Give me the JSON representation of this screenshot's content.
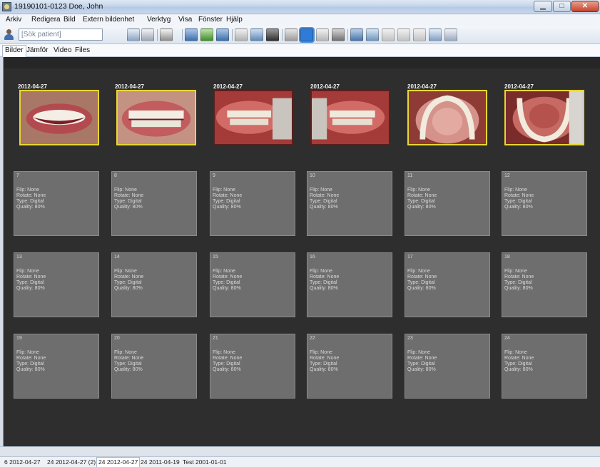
{
  "window": {
    "title": "19190101-0123 Doe, John",
    "min_glyph": "▁",
    "max_glyph": "□",
    "close_glyph": "✕"
  },
  "menu": [
    "Arkiv",
    "Redigera",
    "Bild",
    "Extern bildenhet",
    "Verktyg",
    "Visa",
    "Fönster",
    "Hjälp"
  ],
  "toolbar": {
    "search_placeholder": "[Sök patient]",
    "icons": [
      "folder-grid-icon",
      "grid-view-icon",
      "print-icon",
      "import-icon",
      "export-icon",
      "scan-icon",
      "pencil-icon",
      "monitor-icon",
      "camera-icon",
      "compare-icon",
      "crosshair-move-icon",
      "pan-icon",
      "levels-icon",
      "presentation-icon",
      "image-list-icon",
      "flip-horizontal-icon",
      "flip-vertical-icon",
      "rotate-icon",
      "zoom-icon",
      "checklist-icon"
    ]
  },
  "tabs": [
    "Bilder",
    "Jämför",
    "Video",
    "Files"
  ],
  "photos": [
    {
      "date": "2012-04-27",
      "subject": "smile-frontal",
      "selected": true
    },
    {
      "date": "2012-04-27",
      "subject": "smile-retracted",
      "selected": true
    },
    {
      "date": "2012-04-27",
      "subject": "intraoral-right",
      "selected": false
    },
    {
      "date": "2012-04-27",
      "subject": "intraoral-left",
      "selected": false
    },
    {
      "date": "2012-04-27",
      "subject": "occlusal-upper",
      "selected": true
    },
    {
      "date": "2012-04-27",
      "subject": "occlusal-lower",
      "selected": true
    }
  ],
  "slot_fields": {
    "flip": "Flip: None",
    "rotate": "Rotate: None",
    "type": "Type: Digital",
    "quality": "Quality: 80%"
  },
  "slots": [
    "7",
    "8",
    "9",
    "10",
    "11",
    "12",
    "13",
    "14",
    "15",
    "16",
    "17",
    "18",
    "19",
    "20",
    "21",
    "22",
    "23",
    "24"
  ],
  "bottom_tabs": [
    {
      "label": "6 2012-04-27",
      "selected": false
    },
    {
      "label": "24 2012-04-27 (2)",
      "selected": false
    },
    {
      "label": "24 2012-04-27",
      "selected": true
    },
    {
      "label": "24 2011-04-19",
      "selected": false
    },
    {
      "label": "Test 2001-01-01",
      "selected": false
    }
  ],
  "colors": {
    "viewer_bg": "#2e2e2e",
    "slot_bg": "#6e6e6e",
    "selection": "#e8d633",
    "titlebar": "#c4d5ea"
  }
}
